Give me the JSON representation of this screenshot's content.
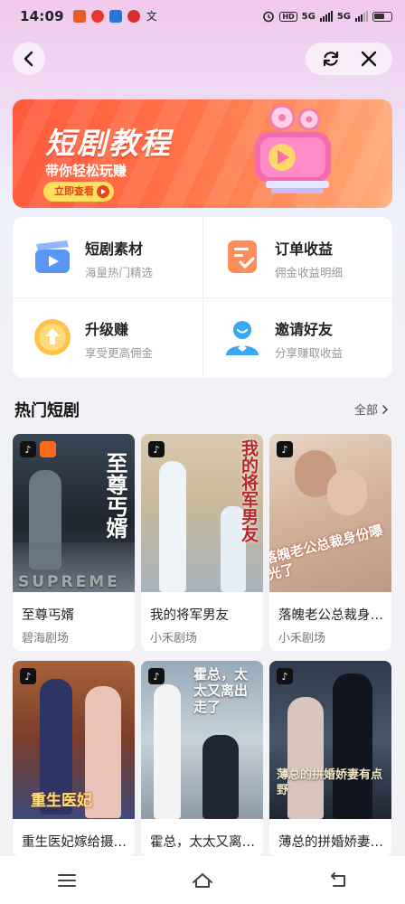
{
  "status_bar": {
    "time": "14:09",
    "network_1": "5G",
    "network_2": "5G",
    "hd_label": "HD"
  },
  "nav": {
    "back_icon": "chevron-left-icon",
    "refresh_icon": "refresh-icon",
    "close_icon": "close-icon"
  },
  "banner": {
    "title": "短剧教程",
    "subtitle": "带你轻松玩赚",
    "button_label": "立即查看",
    "colors": {
      "start": "#ff5a3c",
      "end": "#ffae7c",
      "button": "#ffe05c"
    }
  },
  "features": [
    {
      "title": "短剧素材",
      "subtitle": "海量热门精选",
      "icon": "video-clapper-icon"
    },
    {
      "title": "订单收益",
      "subtitle": "佣金收益明细",
      "icon": "order-document-icon"
    },
    {
      "title": "升级赚",
      "subtitle": "享受更高佣金",
      "icon": "upgrade-coin-icon"
    },
    {
      "title": "邀请好友",
      "subtitle": "分享赚取收益",
      "icon": "invite-user-icon"
    }
  ],
  "section": {
    "title": "热门短剧",
    "more_label": "全部"
  },
  "dramas": [
    {
      "title": "至尊丐婿",
      "source": "碧海剧场",
      "cover_text": "至尊丐婿",
      "cover_text_2": "SUPREME"
    },
    {
      "title": "我的将军男友",
      "source": "小禾剧场",
      "cover_text": "我的将军男友"
    },
    {
      "title": "落魄老公总裁身份曝光了",
      "source": "小禾剧场",
      "cover_text": "落魄老公总裁身份曝光了"
    },
    {
      "title": "重生医妃嫁给摄政王",
      "source": "",
      "cover_text": "重生医妃"
    },
    {
      "title": "霍总，太太又离出走了",
      "source": "",
      "cover_text": "霍总，太太又离出走了"
    },
    {
      "title": "薄总的拼婚娇妻有点野",
      "source": "",
      "cover_text": "薄总的拼婚娇妻有点野"
    }
  ],
  "bottom_nav": {
    "menu_icon": "menu-icon",
    "home_icon": "home-icon",
    "back_icon": "return-icon"
  }
}
